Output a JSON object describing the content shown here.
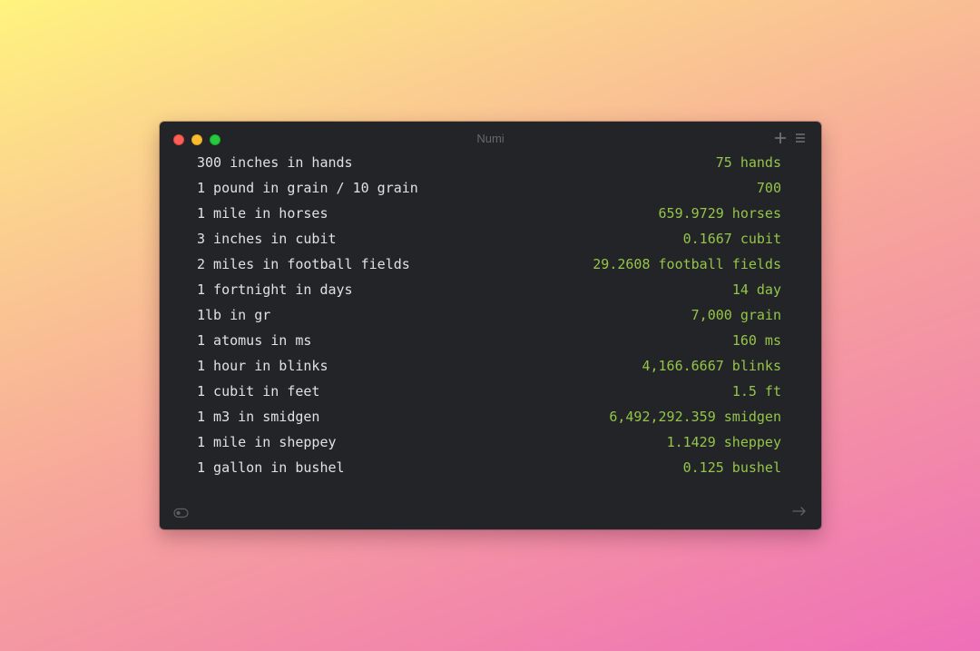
{
  "window": {
    "title": "Numi"
  },
  "lines": [
    {
      "expression": "300 inches in hands",
      "result": "75 hands"
    },
    {
      "expression": "1 pound in grain / 10 grain",
      "result": "700"
    },
    {
      "expression": "1 mile in horses",
      "result": "659.9729 horses"
    },
    {
      "expression": "3 inches in cubit",
      "result": "0.1667 cubit"
    },
    {
      "expression": "2 miles in football fields",
      "result": "29.2608 football fields"
    },
    {
      "expression": "1 fortnight in days",
      "result": "14 day"
    },
    {
      "expression": "1lb in gr",
      "result": "7,000 grain"
    },
    {
      "expression": "1 atomus in ms",
      "result": "160 ms"
    },
    {
      "expression": "1 hour in blinks",
      "result": "4,166.6667 blinks"
    },
    {
      "expression": "1 cubit in feet",
      "result": "1.5 ft"
    },
    {
      "expression": "1 m3 in smidgen",
      "result": "6,492,292.359 smidgen"
    },
    {
      "expression": "1 mile in sheppey",
      "result": "1.1429 sheppey"
    },
    {
      "expression": "1 gallon in bushel",
      "result": "0.125 bushel"
    }
  ],
  "icons": {
    "add": "plus-icon",
    "menu": "hamburger-menu-icon",
    "toggle": "toggle-icon",
    "continue": "arrow-right-icon"
  },
  "colors": {
    "window_background": "#232428",
    "expression_text": "#dfe1e4",
    "result_text": "#94c548",
    "close": "#fe5f57",
    "minimize": "#febc2e",
    "zoom": "#28c840"
  }
}
